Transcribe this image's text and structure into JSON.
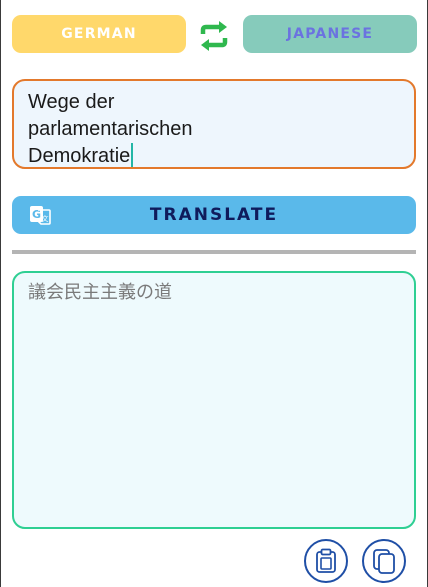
{
  "languages": {
    "source": "GERMAN",
    "target": "JAPANESE"
  },
  "input": {
    "text": "Wege der\nparlamentarischen\nDemokratie"
  },
  "actions": {
    "translate_label": "TRANSLATE"
  },
  "output": {
    "text": "議会民主主義の道"
  },
  "icons": {
    "swap": "swap-arrows-icon",
    "translate": "google-translate-icon",
    "paste": "clipboard-icon",
    "copy": "copy-icon"
  },
  "colors": {
    "source_lang_bg": "#ffd86b",
    "target_lang_bg": "#86cbbb",
    "target_lang_text": "#6b72e0",
    "swap_icon": "#2fb84e",
    "input_border": "#e3792c",
    "translate_bg": "#5ab9ea",
    "translate_text": "#0f1b5c",
    "output_border": "#2fcf93",
    "round_button_border": "#1f4fa6"
  }
}
